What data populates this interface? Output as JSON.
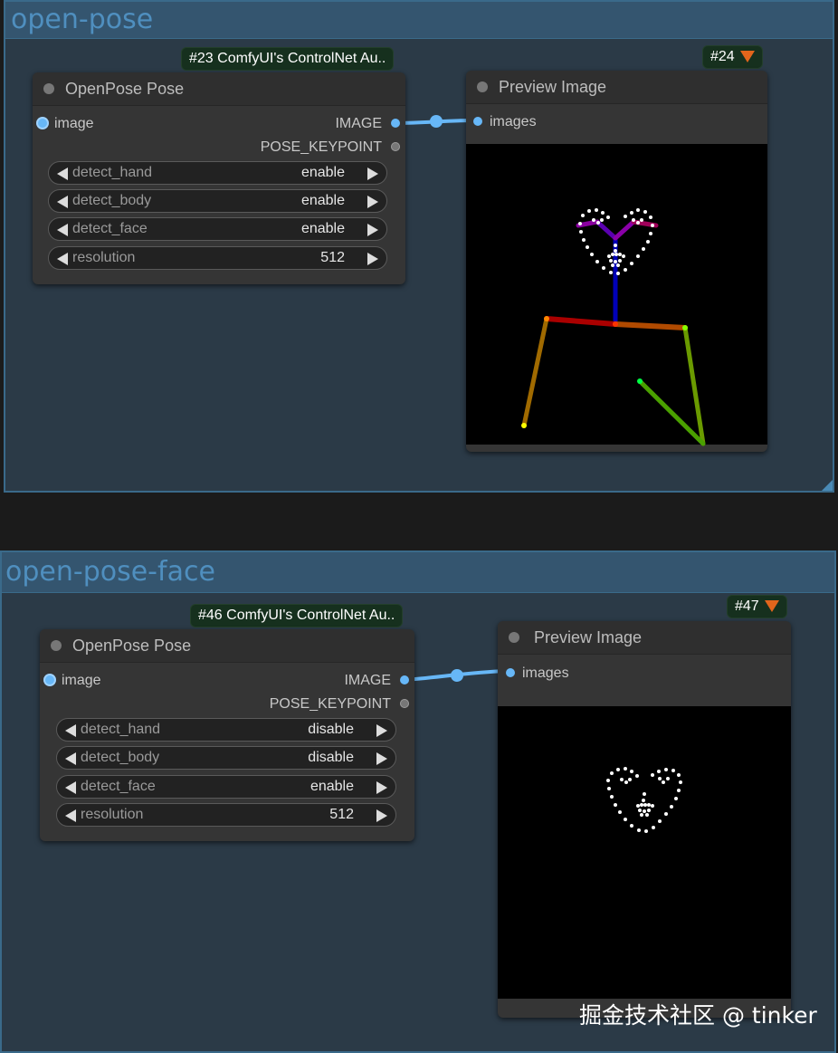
{
  "groups": [
    {
      "title": "open-pose",
      "pose_node": {
        "badge": "#23 ComfyUI's ControlNet Au..",
        "title": "OpenPose Pose",
        "input_label": "image",
        "outputs": [
          "IMAGE",
          "POSE_KEYPOINT"
        ],
        "widgets": [
          {
            "label": "detect_hand",
            "value": "enable"
          },
          {
            "label": "detect_body",
            "value": "enable"
          },
          {
            "label": "detect_face",
            "value": "enable"
          },
          {
            "label": "resolution",
            "value": "512"
          }
        ]
      },
      "preview_node": {
        "badge": "#24",
        "title": "Preview Image",
        "input_label": "images"
      }
    },
    {
      "title": "open-pose-face",
      "pose_node": {
        "badge": "#46 ComfyUI's ControlNet Au..",
        "title": "OpenPose Pose",
        "input_label": "image",
        "outputs": [
          "IMAGE",
          "POSE_KEYPOINT"
        ],
        "widgets": [
          {
            "label": "detect_hand",
            "value": "disable"
          },
          {
            "label": "detect_body",
            "value": "disable"
          },
          {
            "label": "detect_face",
            "value": "enable"
          },
          {
            "label": "resolution",
            "value": "512"
          }
        ]
      },
      "preview_node": {
        "badge": "#47",
        "title": "Preview Image",
        "input_label": "images"
      }
    }
  ],
  "watermark": "掘金技术社区 @ tinker",
  "colors": {
    "canvas": "#1b1b1b",
    "group_bg": "#2b3a47",
    "group_header": "#34556f",
    "group_title": "#4f8fbf",
    "node_bg": "#353535",
    "badge_bg": "#16301e",
    "link": "#67b7f7"
  },
  "icons": [
    "fox-icon",
    "chevron-left-icon",
    "chevron-right-icon",
    "resize-corner-icon"
  ]
}
